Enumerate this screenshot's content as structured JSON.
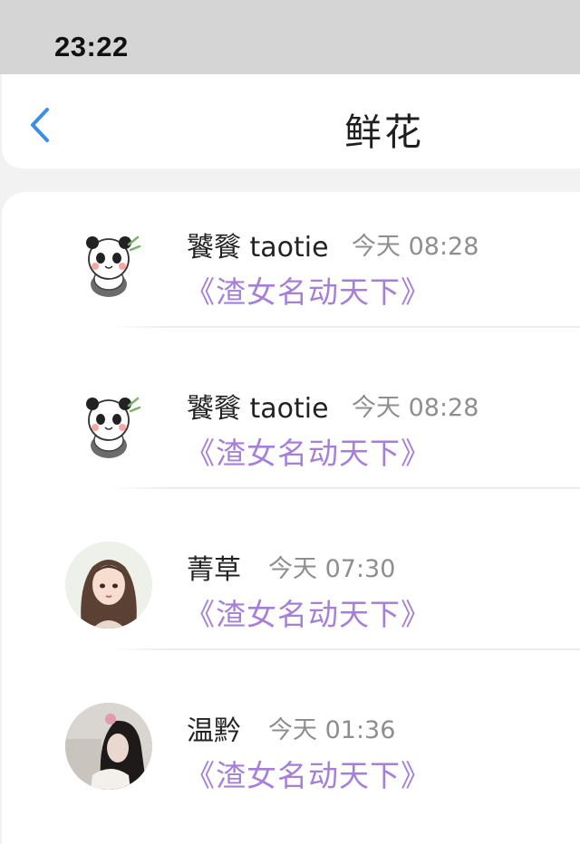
{
  "status_bar": {
    "time": "23:22"
  },
  "nav": {
    "title": "鲜花",
    "back_icon": "chevron-left-icon"
  },
  "items": [
    {
      "name": "饕餮 taotie",
      "time": "今天 08:28",
      "message": "《渣女名动天下》",
      "avatar": "panda-avatar"
    },
    {
      "name": "饕餮 taotie",
      "time": "今天 08:28",
      "message": "《渣女名动天下》",
      "avatar": "panda-avatar"
    },
    {
      "name": "菁草",
      "time": "今天 07:30",
      "message": "《渣女名动天下》",
      "avatar": "girl-illustration-avatar"
    },
    {
      "name": "温黔",
      "time": "今天 01:36",
      "message": "《渣女名动天下》",
      "avatar": "girl-photo-avatar"
    }
  ],
  "colors": {
    "accent": "#3a8ee6",
    "message": "#a67fd8",
    "status_bar": "#d5d5d5"
  }
}
